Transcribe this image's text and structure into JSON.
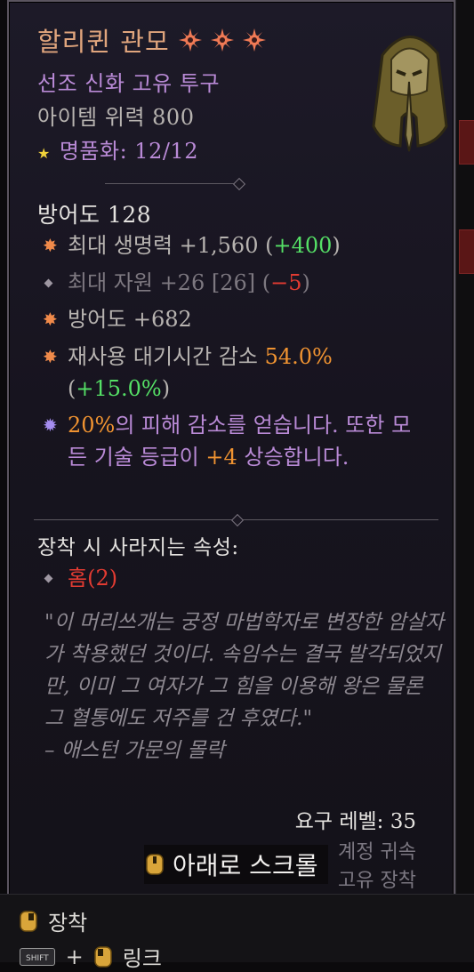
{
  "item": {
    "name": "할리퀸 관모",
    "type": "선조 신화 고유 투구",
    "power": "아이템 위력 800",
    "masterwork": "명품화: 12/12",
    "defense": "방어도 128"
  },
  "affixes": [
    {
      "base": "최대 생명력 +1,560 (",
      "bonus": "+400",
      "close": ")"
    },
    {
      "base": "최대 자원 +26 [26] (",
      "bonus": "−5",
      "close": ")"
    },
    {
      "base": "방어도 +682"
    },
    {
      "base": "재사용 대기시간 감소 ",
      "highlight": "54.0%",
      "mid": " (",
      "bonus": "+15.0%",
      "close": ")"
    }
  ],
  "unique_power": {
    "pre": "20%",
    "mid": "의 피해 감소를 얻습니다. 또한 모든 기술 등급이 ",
    "bonus": "+4",
    "post": " 상승합니다."
  },
  "lost_affixes": {
    "header": "장착 시 사라지는 속성:",
    "socket": "홈(2)"
  },
  "flavor": {
    "quote": "\"이 머리쓰개는 궁정 마법학자로 변장한 암살자가 착용했던 것이다. 속임수는 결국 발각되었지만, 이미 그 여자가 그 힘을 이용해 왕은 물론 그 혈통에도 저주를 건 후였다.\"",
    "source": "– 애스턴 가문의 몰락"
  },
  "requirements": {
    "level": "요구 레벨: 35",
    "account_bound": "계정 귀속",
    "unique_equipped": "고유 장착"
  },
  "scroll_hint": "아래로 스크롤",
  "actions": {
    "equip": "장착",
    "shift_key": "SHIFT",
    "plus": "+",
    "link": "링크"
  },
  "colors": {
    "name": "#e0a57d",
    "type": "#b98ad6",
    "bonus": "#55e066",
    "penalty": "#e23b32",
    "highlight": "#f09331"
  },
  "icons": {
    "sigils": "ancestral-sigil-icon",
    "masterwork": "star-icon",
    "affix_greater": "greater-affix-icon",
    "affix_normal": "diamond-bullet-icon",
    "unique": "unique-power-icon",
    "mouse": "mouse-button-icon",
    "shift": "shift-key-icon"
  }
}
